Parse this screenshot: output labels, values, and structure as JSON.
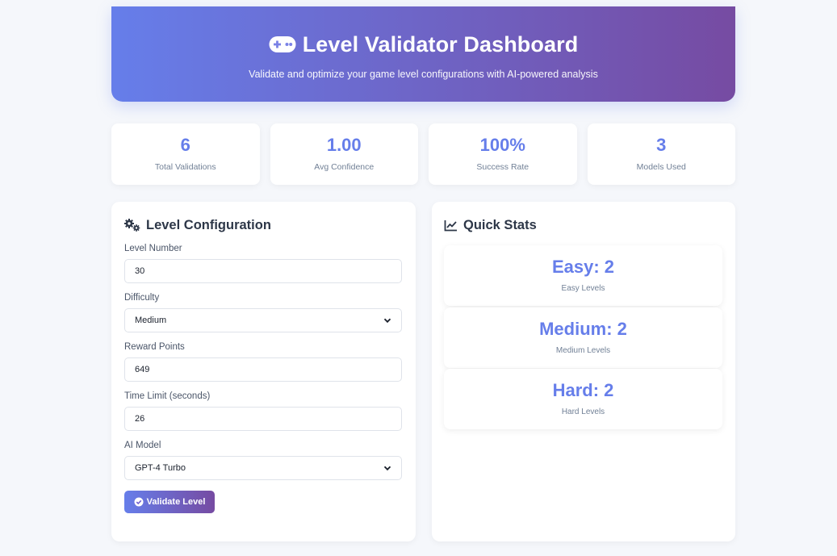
{
  "header": {
    "title": "Level Validator Dashboard",
    "subtitle": "Validate and optimize your game level configurations with AI-powered analysis",
    "icon": "gamepad-icon"
  },
  "stats": [
    {
      "value": "6",
      "label": "Total Validations"
    },
    {
      "value": "1.00",
      "label": "Avg Confidence"
    },
    {
      "value": "100%",
      "label": "Success Rate"
    },
    {
      "value": "3",
      "label": "Models Used"
    }
  ],
  "config": {
    "title": "Level Configuration",
    "icon": "gears-icon",
    "level_number": {
      "label": "Level Number",
      "value": "30"
    },
    "difficulty": {
      "label": "Difficulty",
      "value": "Medium"
    },
    "reward_points": {
      "label": "Reward Points",
      "value": "649"
    },
    "time_limit": {
      "label": "Time Limit (seconds)",
      "value": "26"
    },
    "ai_model": {
      "label": "AI Model",
      "value": "GPT-4 Turbo"
    },
    "validate_button": "Validate Level"
  },
  "quick_stats": {
    "title": "Quick Stats",
    "icon": "line-chart-icon",
    "items": [
      {
        "value": "Easy: 2",
        "label": "Easy Levels"
      },
      {
        "value": "Medium: 2",
        "label": "Medium Levels"
      },
      {
        "value": "Hard: 2",
        "label": "Hard Levels"
      }
    ]
  },
  "colors": {
    "accent": "#667eea",
    "gradient_start": "#667eea",
    "gradient_end": "#764ba2"
  }
}
